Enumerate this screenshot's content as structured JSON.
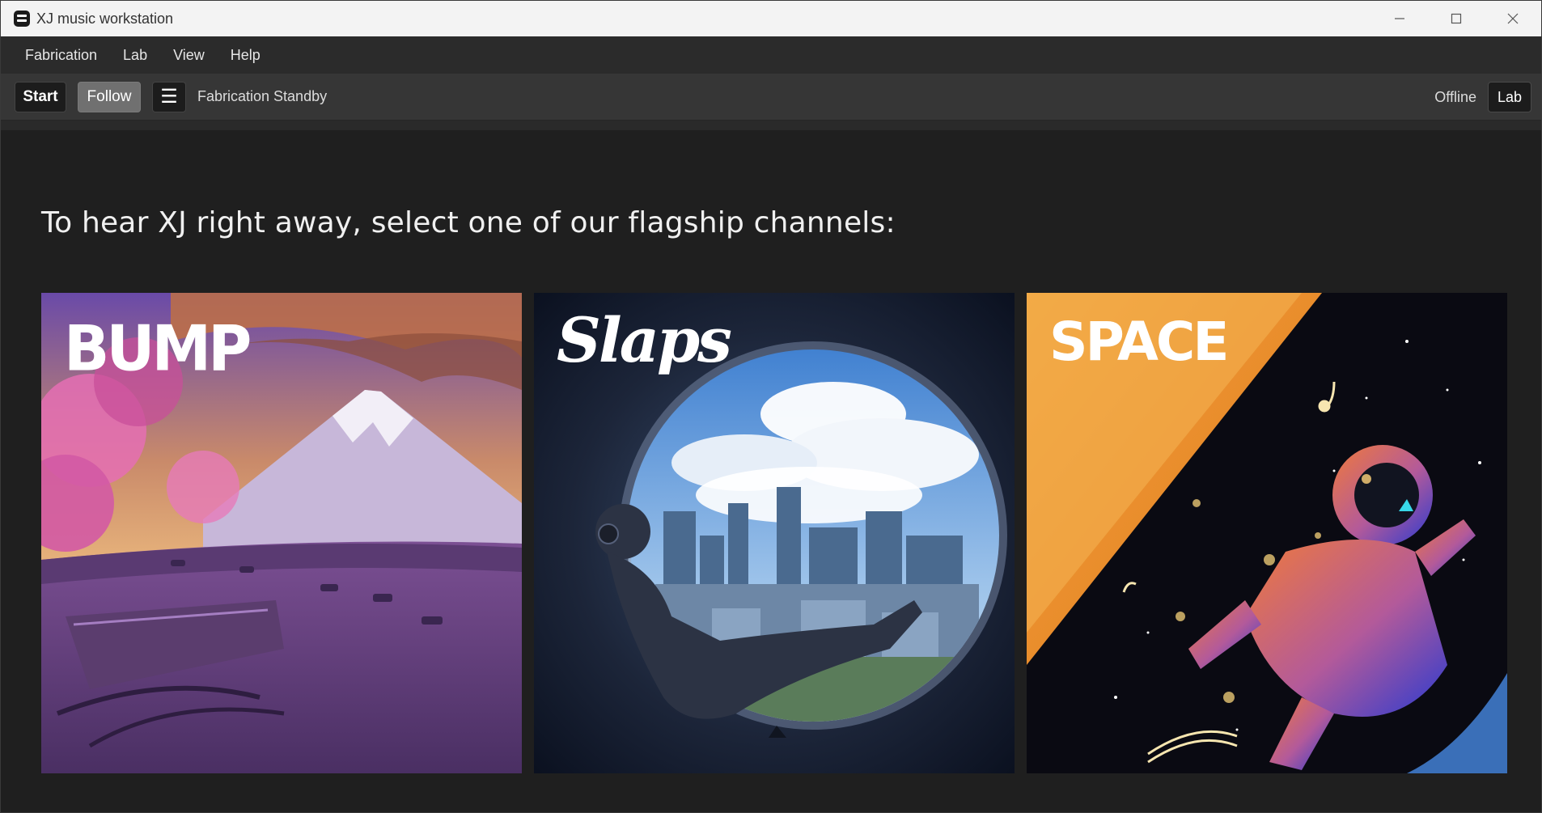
{
  "window": {
    "title": "XJ music workstation"
  },
  "menu": [
    "Fabrication",
    "Lab",
    "View",
    "Help"
  ],
  "toolbar": {
    "start_label": "Start",
    "follow_label": "Follow",
    "menu_glyph": "☰",
    "status": "Fabrication Standby",
    "connection": "Offline",
    "lab_label": "Lab"
  },
  "main": {
    "headline": "To hear XJ right away, select one of our flagship channels:",
    "channels": [
      {
        "label": "BUMP",
        "icon": "mountain-lounge-artwork"
      },
      {
        "label": "Slaps",
        "icon": "window-city-artwork"
      },
      {
        "label": "SPACE",
        "icon": "astronaut-artwork"
      }
    ]
  },
  "colors": {
    "background": "#1f1f1f",
    "toolbar": "#363636",
    "menubar": "#2b2b2b",
    "titlebar": "#f3f3f3"
  }
}
